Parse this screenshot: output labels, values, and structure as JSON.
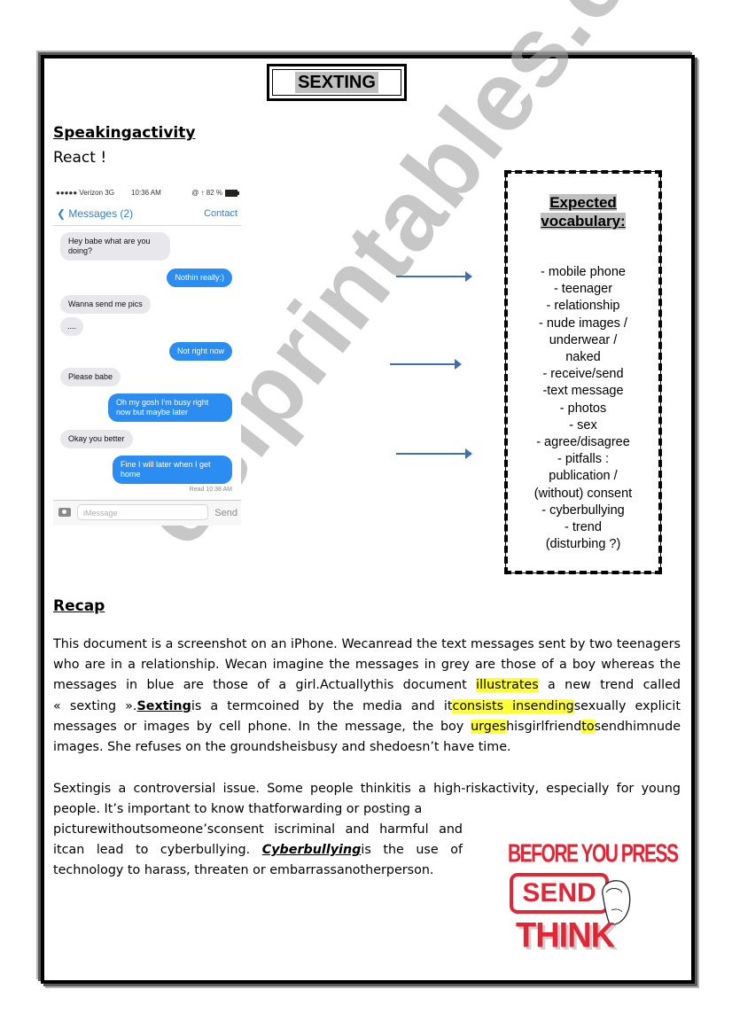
{
  "title": "SEXTING",
  "speaking": {
    "heading": "Speakingactivity",
    "instruction": "React !"
  },
  "phone": {
    "status": {
      "carrier": "●●●●● Verizon  3G",
      "time": "10:36 AM",
      "battery": "@ ↑ 82 %"
    },
    "nav": {
      "back_label": "❮ Messages (2)",
      "contact_label": "Contact"
    },
    "messages": [
      {
        "sender": "boy",
        "color": "grey",
        "text": "Hey babe what are you doing?"
      },
      {
        "sender": "girl",
        "color": "blue",
        "text": "Nothin really:)"
      },
      {
        "sender": "boy",
        "color": "grey",
        "text": "Wanna send me pics"
      },
      {
        "sender": "boy",
        "color": "grey",
        "text": "...."
      },
      {
        "sender": "girl",
        "color": "blue",
        "text": "Not right now"
      },
      {
        "sender": "boy",
        "color": "grey",
        "text": "Please babe"
      },
      {
        "sender": "girl",
        "color": "blue",
        "text": "Oh my gosh I'm busy right now but maybe later"
      },
      {
        "sender": "boy",
        "color": "grey",
        "text": "Okay you better"
      },
      {
        "sender": "girl",
        "color": "blue",
        "text": "Fine I will later when I get home"
      }
    ],
    "read_receipt": "Read 10:38 AM",
    "input_placeholder": "iMessage",
    "send_label": "Send",
    "colors": {
      "blue_bubble": "#2b8cf1",
      "grey_bubble": "#e7e7ec",
      "link_blue": "#2f7fd6"
    }
  },
  "vocabulary": {
    "title_line1": "Expected",
    "title_line2": "vocabulary:",
    "items": [
      "- mobile phone",
      "- teenager",
      "- relationship",
      "- nude images /",
      "underwear /",
      "naked",
      "- receive/send",
      "-text message",
      "- photos",
      "- sex",
      "- agree/disagree",
      "- pitfalls :",
      "publication /",
      "(without) consent",
      "- cyberbullying",
      "- trend",
      "(disturbing ?)"
    ]
  },
  "recap": {
    "heading": "Recap",
    "p1": {
      "a": "This document is a screenshot on an iPhone. Wecanread the text messages sent by two teenagers who are in a relationship. Wecan imagine the messages in grey are those of a boy whereas the messages in blue are those of a girl.Actuallythis document ",
      "hl1": "illustrates",
      "b": " a new trend called « sexting ».",
      "term1": "Sexting",
      "c": "is a termcoined by the media and it",
      "hl2": "consists in",
      "hl3": "sending",
      "d": "sexually explicit messages or images by cell phone. In the message, the boy ",
      "hl4": "urges",
      "e": "hisgirlfriend",
      "hl5": "to",
      "f": "sendhimnude images. She refuses on the groundsheisbusy and shedoesn’t have time."
    },
    "p2": "Sextingis a controversial issue.  Some people thinkitis a high-riskactivity, especially for young people.  It’s important to know thatforwarding or posting a",
    "p3": {
      "a": "picturewithoutsomeone’sconsent iscriminal and harmful and itcan lead to cyberbullying. ",
      "term": "Cyberbullying",
      "b": "is the use of technology to harass, threaten or embarrassanotherperson."
    }
  },
  "poster": {
    "line1": "BEFORE YOU PRESS",
    "button": "SEND",
    "line3": "THINK",
    "color": "#e32636"
  },
  "watermark": "eslprintables.com",
  "highlight_color": "#ffff33"
}
